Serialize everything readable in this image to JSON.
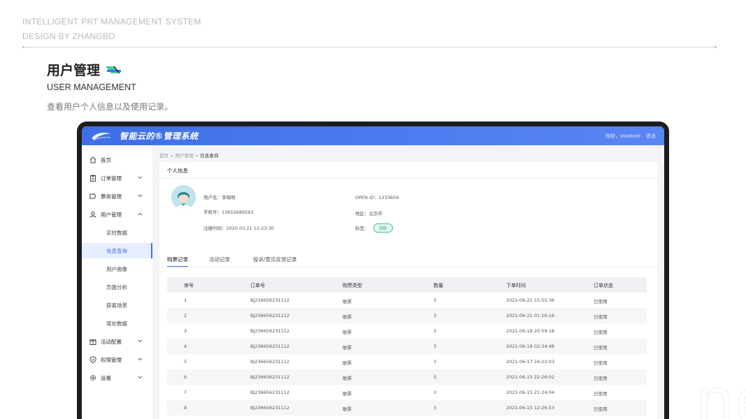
{
  "page": {
    "header_line1": "INTELLIGENT PRT MANAGEMENT SYSTEM",
    "header_line2": "DESIGN BY ZHANGBO",
    "section_title": "用户管理",
    "section_subtitle": "USER MANAGEMENT",
    "section_desc": "查看用户个人信息以及使用记录。",
    "watermark": "ne"
  },
  "app": {
    "title": "智能云的®管理系统",
    "greeting": "你好，xiaobozi",
    "logout": "退出",
    "accent_color": "#3f6fe6"
  },
  "sidebar": {
    "items": [
      {
        "label": "首页",
        "icon": "home-icon"
      },
      {
        "label": "订单管理",
        "icon": "clipboard-icon"
      },
      {
        "label": "票务管理",
        "icon": "ticket-icon"
      },
      {
        "label": "用户管理",
        "icon": "user-icon"
      },
      {
        "label": "活动配置",
        "icon": "gift-icon"
      },
      {
        "label": "权限管理",
        "icon": "shield-icon"
      },
      {
        "label": "设置",
        "icon": "gear-icon"
      }
    ],
    "sub_items": [
      {
        "label": "实时数据"
      },
      {
        "label": "信息查询"
      },
      {
        "label": "用户画像"
      },
      {
        "label": "页面分析"
      },
      {
        "label": "获客场景"
      },
      {
        "label": "增长数据"
      }
    ]
  },
  "breadcrumb": {
    "home": "首页",
    "sep": ">",
    "parent": "用户管理",
    "current": "信息查询"
  },
  "profile": {
    "card_title": "个人信息",
    "username_label": "用户名：",
    "username": "李晓明",
    "phone_label": "手机号：",
    "phone": "13655689563",
    "reg_label": "注册时间：",
    "reg_time": "2020.03.21  12:23:30",
    "openid_label": "OPEN ID：",
    "openid": "1233656",
    "region_label": "地区：",
    "region": "北京市",
    "tags_label": "标签：",
    "tag": "活跃"
  },
  "tabs": [
    {
      "label": "购票记录",
      "active": true
    },
    {
      "label": "活动记录",
      "active": false
    },
    {
      "label": "投诉/意见反馈记录",
      "active": false
    }
  ],
  "table": {
    "columns": [
      "序号",
      "订单号",
      "购票类型",
      "数量",
      "下单时间",
      "订单状态"
    ],
    "rows": [
      [
        "1",
        "BJ236656231112",
        "联票",
        "3",
        "2021-06-21 15:55:36",
        "已使用"
      ],
      [
        "2",
        "BJ236656231112",
        "联票",
        "3",
        "2021-06-21 01:16:16",
        "已使用"
      ],
      [
        "3",
        "BJ236656231112",
        "联票",
        "3",
        "2021-06-18 20:59:18",
        "已使用"
      ],
      [
        "4",
        "BJ236656231112",
        "联票",
        "3",
        "2021-06-18 02:34:48",
        "已使用"
      ],
      [
        "5",
        "BJ236656231112",
        "联票",
        "3",
        "2021-06-17 16:22:03",
        "已使用"
      ],
      [
        "6",
        "BJ236656231112",
        "联票",
        "3",
        "2021-06-15 22:26:02",
        "已使用"
      ],
      [
        "7",
        "BJ236656231112",
        "联票",
        "3",
        "2021-06-15 21:24:04",
        "已使用"
      ],
      [
        "8",
        "BJ236656231112",
        "联票",
        "3",
        "2021-06-15 12:26:53",
        "已使用"
      ]
    ]
  }
}
